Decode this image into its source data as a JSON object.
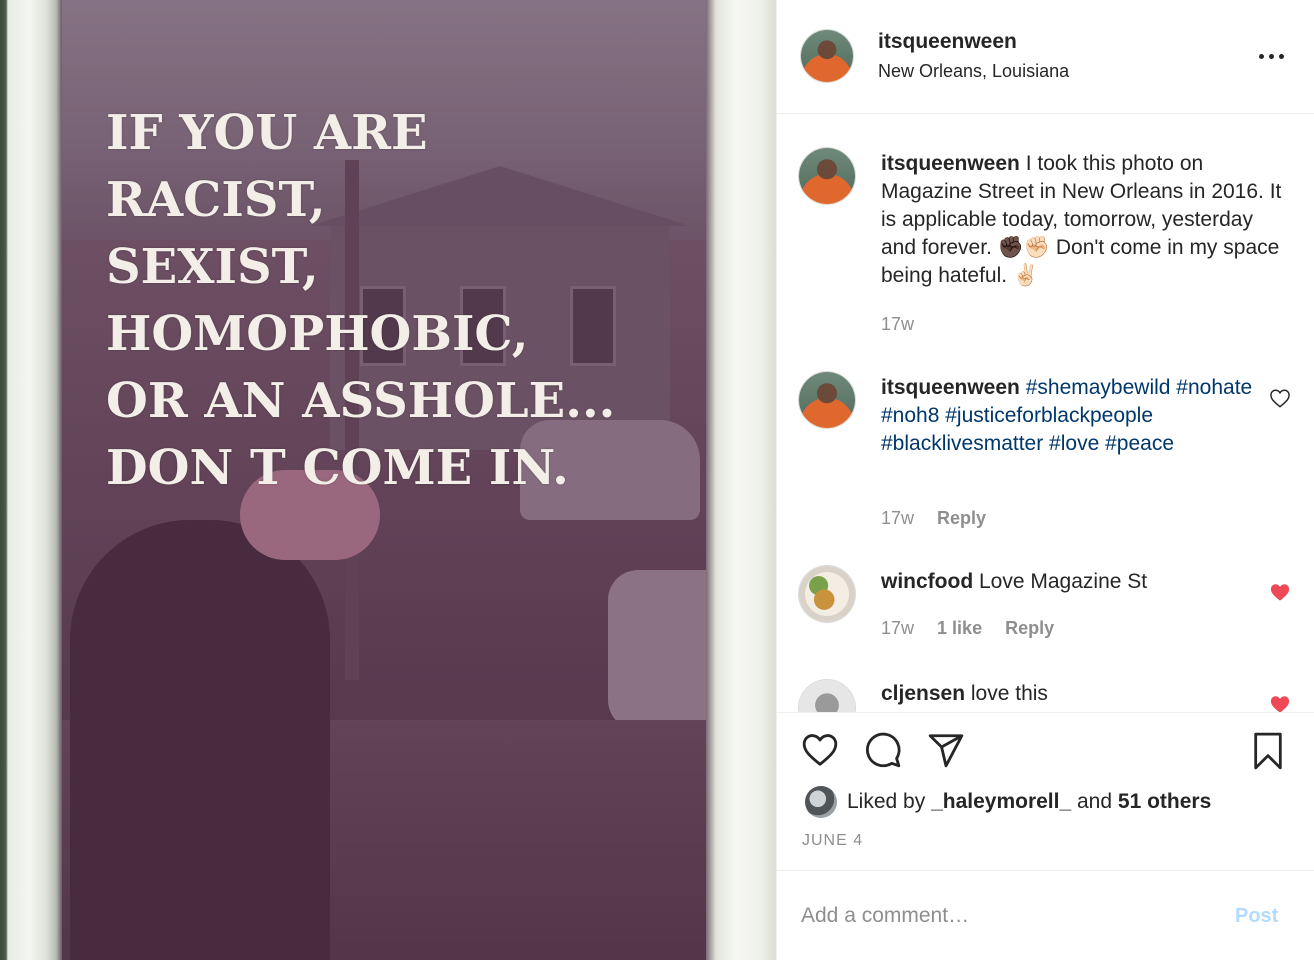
{
  "photo": {
    "sign_lines": [
      "IF YOU ARE",
      "RACIST,",
      "SEXIST,",
      "HOMOPHOBIC,",
      "OR AN ASSHOLE...",
      "DON T COME IN."
    ]
  },
  "header": {
    "username": "itsqueenween",
    "location": "New Orleans, Louisiana",
    "more_icon": "more-horizontal-icon"
  },
  "comments": [
    {
      "username": "itsqueenween",
      "text": "I took this photo on Magazine Street in New Orleans in 2016. It is applicable today, tomorrow, yesterday and forever. ✊🏿✊🏻 Don't come in my space being hateful. ✌🏻",
      "time": "17w"
    },
    {
      "username": "itsqueenween",
      "text": "#shemaybewild #nohate #noh8 #justiceforblackpeople #blacklivesmatter #love #peace",
      "time": "17w",
      "reply": "Reply",
      "liked": false
    },
    {
      "username": "wincfood",
      "text": "Love Magazine St",
      "time": "17w",
      "likes": "1 like",
      "reply": "Reply",
      "liked": true
    },
    {
      "username": "cljensen",
      "text": "love this",
      "liked": true
    }
  ],
  "actions": {
    "icons": [
      "heart-icon",
      "comment-icon",
      "share-icon",
      "bookmark-icon"
    ]
  },
  "likes": {
    "prefix": "Liked by",
    "user": "_haleymorell_",
    "middle": "and",
    "others": "51 others"
  },
  "date": "JUNE 4",
  "add_comment": {
    "placeholder": "Add a comment…",
    "post_label": "Post"
  },
  "colors": {
    "hashtag": "#00376b",
    "like_red": "#ed4956",
    "post_disabled": "#b3dbff",
    "muted": "#8e8e8e"
  }
}
